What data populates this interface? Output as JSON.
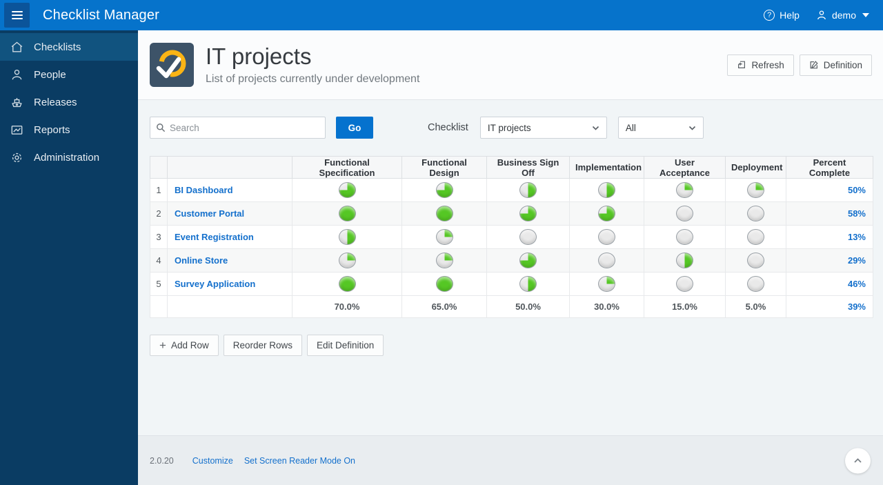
{
  "app": {
    "title": "Checklist Manager",
    "help_label": "Help",
    "user_label": "demo"
  },
  "sidebar": {
    "items": [
      {
        "label": "Checklists",
        "icon": "home-icon",
        "active": true
      },
      {
        "label": "People",
        "icon": "person-icon",
        "active": false
      },
      {
        "label": "Releases",
        "icon": "ship-icon",
        "active": false
      },
      {
        "label": "Reports",
        "icon": "chart-icon",
        "active": false
      },
      {
        "label": "Administration",
        "icon": "gear-icon",
        "active": false
      }
    ]
  },
  "page": {
    "title": "IT projects",
    "subtitle": "List of projects currently under development",
    "refresh_label": "Refresh",
    "definition_label": "Definition"
  },
  "filters": {
    "search_placeholder": "Search",
    "go_label": "Go",
    "checklist_label": "Checklist",
    "checklist_value": "IT projects",
    "scope_value": "All"
  },
  "table": {
    "columns": [
      "",
      "",
      "Functional Specification",
      "Functional Design",
      "Business Sign Off",
      "Implementation",
      "User Acceptance",
      "Deployment",
      "Percent Complete"
    ],
    "rows": [
      {
        "num": "1",
        "name": "BI Dashboard",
        "stages": [
          75,
          75,
          50,
          50,
          25,
          25
        ],
        "percent": "50%"
      },
      {
        "num": "2",
        "name": "Customer Portal",
        "stages": [
          100,
          100,
          75,
          75,
          0,
          0
        ],
        "percent": "58%"
      },
      {
        "num": "3",
        "name": "Event Registration",
        "stages": [
          50,
          25,
          0,
          0,
          0,
          0
        ],
        "percent": "13%"
      },
      {
        "num": "4",
        "name": "Online Store",
        "stages": [
          25,
          25,
          75,
          0,
          50,
          0
        ],
        "percent": "29%"
      },
      {
        "num": "5",
        "name": "Survey Application",
        "stages": [
          100,
          100,
          50,
          25,
          0,
          0
        ],
        "percent": "46%"
      }
    ],
    "totals": {
      "values": [
        "70.0%",
        "65.0%",
        "50.0%",
        "30.0%",
        "15.0%",
        "5.0%"
      ],
      "percent": "39%"
    }
  },
  "actions": {
    "add_row": "Add Row",
    "reorder_rows": "Reorder Rows",
    "edit_definition": "Edit Definition"
  },
  "footer": {
    "version": "2.0.20",
    "customize": "Customize",
    "screen_reader": "Set Screen Reader Mode On"
  },
  "icons": {
    "help_glyph": "?"
  },
  "colors": {
    "header_blue": "#0673cb",
    "sidebar_navy": "#0a3c63",
    "active_item_blue": "#11537f",
    "link_blue": "#1470cc",
    "pie_green": "#55c724",
    "pie_empty": "#e9e9e9",
    "badge_slate": "#3d5368",
    "badge_amber": "#fbb415"
  }
}
